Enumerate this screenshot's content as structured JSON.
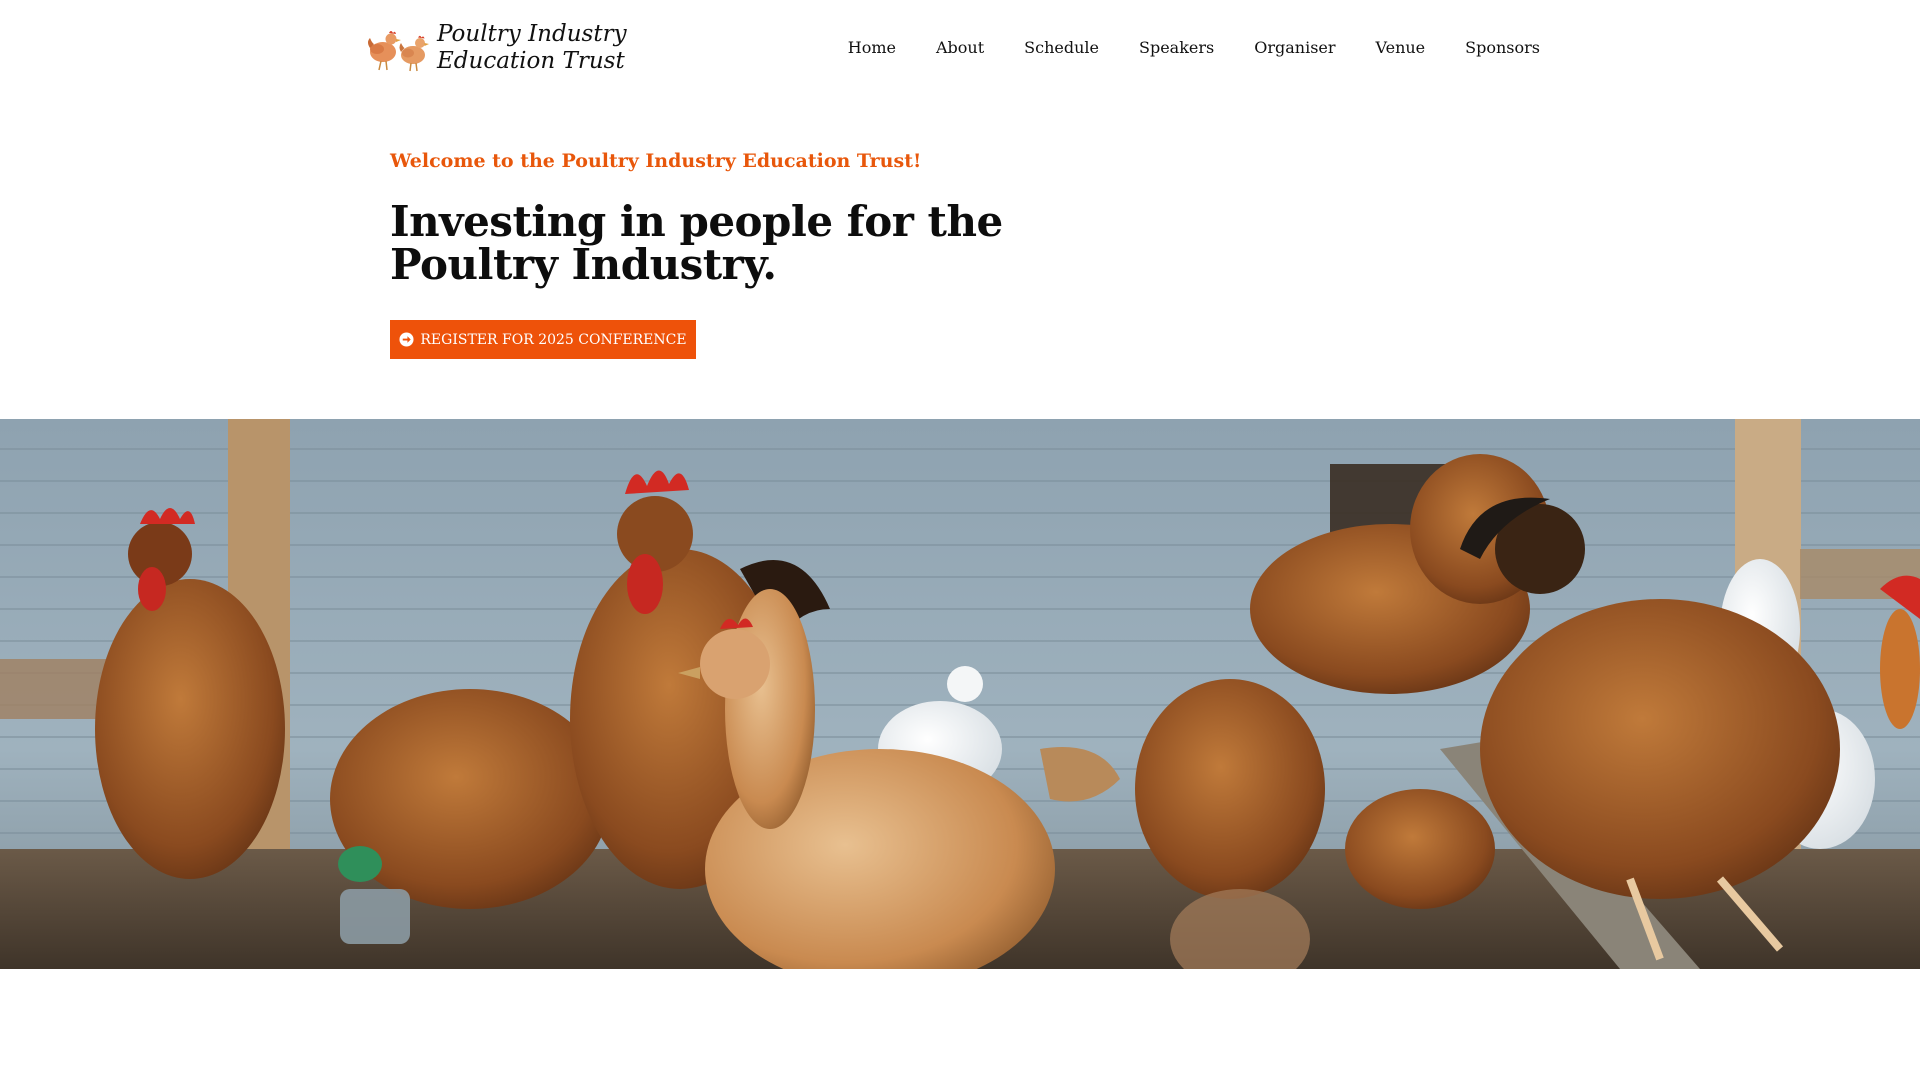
{
  "site": {
    "logo_line1": "Poultry Industry",
    "logo_line2": "Education Trust",
    "logo_icon": "hens-logo-icon"
  },
  "nav": {
    "items": [
      {
        "label": "Home"
      },
      {
        "label": "About"
      },
      {
        "label": "Schedule"
      },
      {
        "label": "Speakers"
      },
      {
        "label": "Organiser"
      },
      {
        "label": "Venue"
      },
      {
        "label": "Sponsors"
      }
    ]
  },
  "hero": {
    "welcome": "Welcome to the Poultry Industry Education Trust!",
    "headline": "Investing in people for the Poultry Industry.",
    "cta_label": "REGISTER FOR 2025 CONFERENCE",
    "cta_icon": "arrow-circle-right-icon"
  },
  "colors": {
    "accent": "#ee520a",
    "welcome_text": "#e8570b",
    "heading_text": "#0d0d0d",
    "background": "#ffffff"
  },
  "banner": {
    "subject": "photo-chickens-in-coop"
  }
}
